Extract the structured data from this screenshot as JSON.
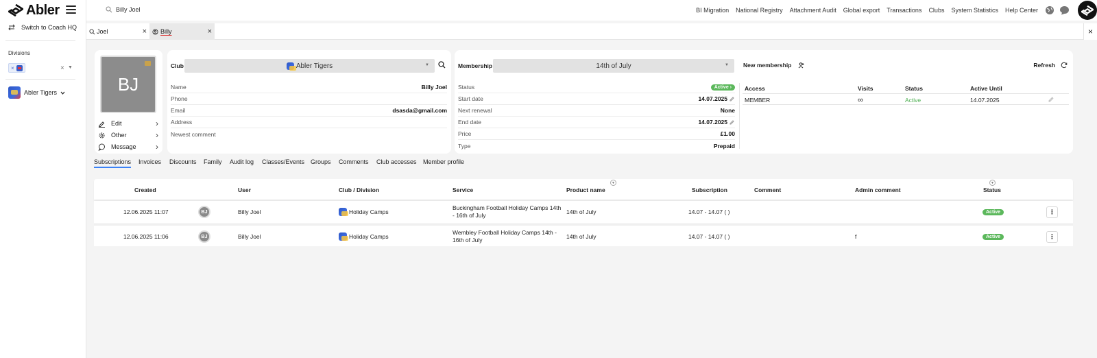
{
  "app": {
    "name": "Abler"
  },
  "sidebar": {
    "switch_label": "Switch to Coach HQ",
    "divisions_label": "Divisions",
    "division_chip_x": "×",
    "clear_icon": "×",
    "club": "Abler Tigers"
  },
  "topbar": {
    "search_value": "Billy Joel",
    "links": [
      "BI Migration",
      "National Registry",
      "Attachment Audit",
      "Global export",
      "Transactions",
      "Clubs",
      "System Statistics",
      "Help Center"
    ]
  },
  "tabs": [
    {
      "label": "Joel",
      "icon": "search-icon"
    },
    {
      "label": "Billy",
      "icon": "user-circle-icon"
    }
  ],
  "profile": {
    "initials": "BJ",
    "actions": [
      "Edit",
      "Other",
      "Message"
    ]
  },
  "club_card": {
    "club_label": "Club",
    "club_value": "Abler Tigers",
    "fields": [
      {
        "key": "Name",
        "value": "Billy Joel"
      },
      {
        "key": "Phone",
        "value": ""
      },
      {
        "key": "Email",
        "value": "dsasda@gmail.com"
      },
      {
        "key": "Address",
        "value": ""
      },
      {
        "key": "Newest comment",
        "value": ""
      }
    ]
  },
  "membership_card": {
    "membership_label": "Membership",
    "membership_value": "14th of July",
    "new_membership_label": "New membership",
    "refresh_label": "Refresh",
    "status_key": "Status",
    "status_value": "Active",
    "fields": [
      {
        "key": "Start date",
        "value": "14.07.2025"
      },
      {
        "key": "Next renewal",
        "value": "None"
      },
      {
        "key": "End date",
        "value": "14.07.2025"
      },
      {
        "key": "Price",
        "value": "£1.00"
      },
      {
        "key": "Type",
        "value": "Prepaid"
      }
    ],
    "access_headers": [
      "Access",
      "Visits",
      "Status",
      "Active Until"
    ],
    "access_row": {
      "access": "MEMBER",
      "visits": "∞",
      "status": "Active",
      "until": "14.07.2025"
    }
  },
  "subtabs": [
    "Subscriptions",
    "Invoices",
    "Discounts",
    "Family",
    "Audit log",
    "Classes/Events",
    "Groups",
    "Comments",
    "Club accesses",
    "Member profile"
  ],
  "table": {
    "headers": [
      "Created",
      "User",
      "Club / Division",
      "Service",
      "Product name",
      "Subscription",
      "Comment",
      "Admin comment",
      "Status"
    ],
    "rows": [
      {
        "created": "12.06.2025 11:07",
        "initials": "BJ",
        "user": "Billy Joel",
        "club": "Holiday Camps",
        "service": "Buckingham Football Holiday Camps 14th - 16th of July",
        "product": "14th of July",
        "subscription": "14.07 - 14.07 ( )",
        "comment": "",
        "admin_comment": "",
        "status": "Active"
      },
      {
        "created": "12.06.2025 11:06",
        "initials": "BJ",
        "user": "Billy Joel",
        "club": "Holiday Camps",
        "service": "Wembley Football Holiday Camps 14th - 16th of July",
        "product": "14th of July",
        "subscription": "14.07 - 14.07 ( )",
        "comment": "",
        "admin_comment": "f",
        "status": "Active"
      }
    ]
  },
  "colors": {
    "accent": "#3b82f6",
    "active_green": "#5cb85c",
    "tab_underline": "#dd3333"
  }
}
